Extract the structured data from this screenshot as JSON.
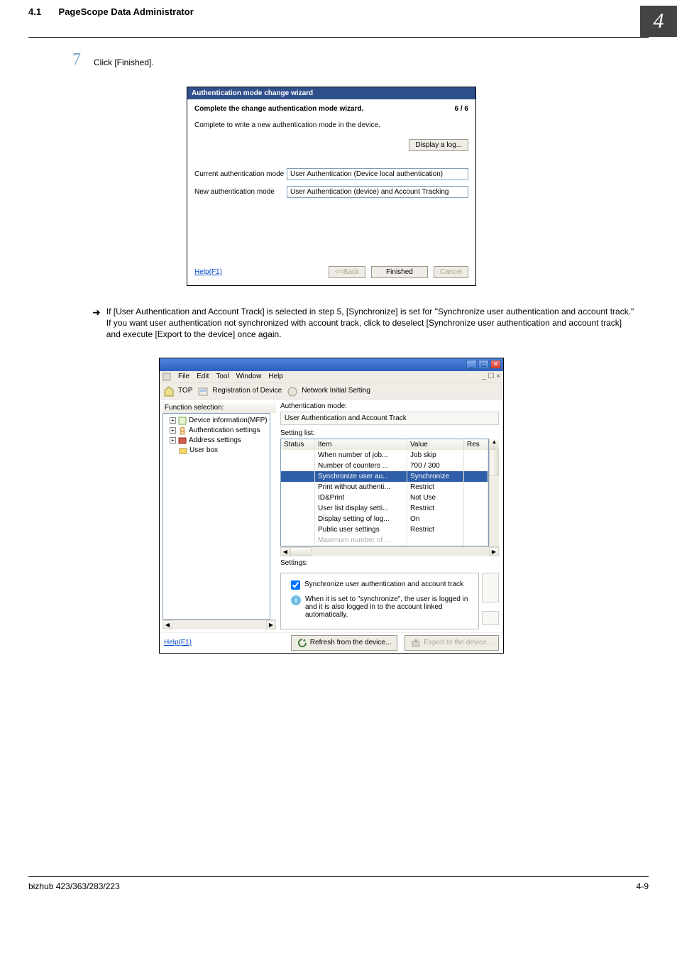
{
  "header": {
    "section_number": "4.1",
    "section_title": "PageScope Data Administrator",
    "chapter_mark": "4"
  },
  "step": {
    "number": "7",
    "text": "Click [Finished]."
  },
  "dialog1": {
    "title": "Authentication mode change wizard",
    "heading": "Complete the change authentication mode wizard.",
    "page_indicator": "6 / 6",
    "subheading": "Complete to write a new authentication mode in the device.",
    "display_log_btn": "Display a log...",
    "rows": [
      {
        "label": "Current authentication mode",
        "value": "User Authentication (Device local authentication)"
      },
      {
        "label": "New authentication mode",
        "value": "User Authentication (device) and Account Tracking"
      }
    ],
    "help_label": "Help(F1)",
    "back_btn": "<<Back",
    "finished_btn": "Finished",
    "cancel_btn": "Cancel"
  },
  "note": "If [User Authentication and Account Track] is selected in step 5, [Synchronize] is set for \"Synchronize user authentication and account track.\" If you want user authentication not synchronized with account track, click to deselect [Synchronize user authentication and account track] and execute [Export to the device] once again.",
  "dialog2": {
    "menubar": [
      "File",
      "Edit",
      "Tool",
      "Window",
      "Help"
    ],
    "mdi_ctrls": "_  ☐  ×",
    "toolbar": [
      "TOP",
      "Registration of Device",
      "Network Initial Setting"
    ],
    "tree_header": "Function selection:",
    "tree_items": [
      "Device information(MFP)",
      "Authentication settings",
      "Address settings",
      "User box"
    ],
    "auth_mode_label": "Authentication mode:",
    "auth_mode_value": "User Authentication and Account Track",
    "setting_list_label": "Setting list:",
    "grid_headers": {
      "status": "Status",
      "item": "Item",
      "value": "Value",
      "res": "Res"
    },
    "grid_rows": [
      {
        "item": "When number of job...",
        "value": "Job skip",
        "sel": false
      },
      {
        "item": "Number of counters ...",
        "value": "700 / 300",
        "sel": false
      },
      {
        "item": "Synchronize user au...",
        "value": "Synchronize",
        "sel": true
      },
      {
        "item": "Print without authenti...",
        "value": "Restrict",
        "sel": false
      },
      {
        "item": "ID&Print",
        "value": "Not Use",
        "sel": false
      },
      {
        "item": "User list display setti...",
        "value": "Restrict",
        "sel": false
      },
      {
        "item": "Display setting of log...",
        "value": "On",
        "sel": false
      },
      {
        "item": "Public user settings",
        "value": "Restrict",
        "sel": false
      },
      {
        "item": "Maximum number of ...",
        "value": "",
        "sel": false,
        "dim": true
      }
    ],
    "settings_label": "Settings:",
    "checkbox_label": "Synchronize user authentication and account track",
    "info_text": "When it is set to \"synchronize\", the user is logged in and it is also logged in to the account linked automatically.",
    "help_label": "Help(F1)",
    "refresh_btn": "Refresh from the device...",
    "export_btn": "Export to the device..."
  },
  "footer": {
    "left": "bizhub 423/363/283/223",
    "right": "4-9"
  }
}
